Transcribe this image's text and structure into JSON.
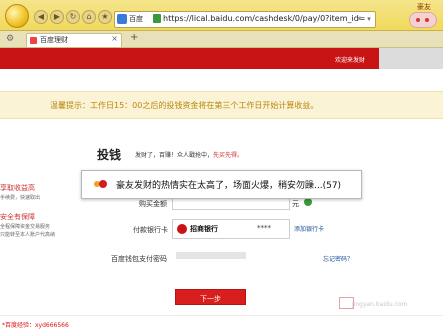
{
  "browser": {
    "site_badge": "百度",
    "url": "https://lical.baidu.com/cashdesk/0/pay/0?item_id=",
    "tab_label": "百度理财",
    "tab_close": "×",
    "new_tab": "+",
    "mascot_text": "豪友"
  },
  "header": {
    "welcome": "欢迎来发财"
  },
  "notice": {
    "text": "温馨提示：工作日15：00之后的投钱资金将在第三个工作日开始计算收益。"
  },
  "sidebar": {
    "line1": "享取收益高",
    "line2": "手续费，快速取出",
    "line3": "安全有保障",
    "line4": "全程保障资金交易服务",
    "line5": "只能转至本人账户代高纳"
  },
  "panel": {
    "title": "投钱",
    "subtitle": "发财了，百赚！众人戳抢中，",
    "subtitle_link": "先买先得。"
  },
  "toast": {
    "text": "豪友发财的热情实在太高了，场面火爆，稍安勿躁...(57)"
  },
  "form": {
    "amount_label": "购买金额",
    "unit": "元",
    "bank_label": "付款银行卡",
    "bank_name": "招商银行",
    "bank_mask": "****",
    "add_bank": "添加银行卡",
    "pwd_label": "百度钱包支付密码",
    "forgot": "忘记密码？"
  },
  "actions": {
    "next_label": "下一步"
  },
  "watermark": {
    "text": "jingyan.baidu.com"
  },
  "footer": {
    "text": "*百度经验：xyd666566"
  }
}
